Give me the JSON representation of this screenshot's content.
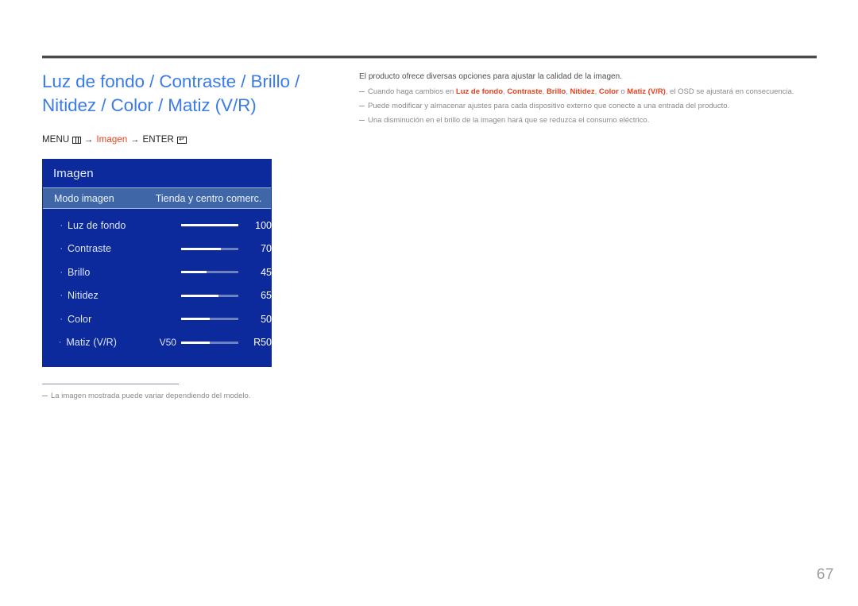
{
  "page": {
    "number": "67",
    "title": "Luz de fondo / Contraste / Brillo /\nNitidez / Color / Matiz (V/R)"
  },
  "breadcrumb": {
    "menu_label": "MENU",
    "menu_icon": "menu-grid-icon",
    "arrow1": "→",
    "target": "Imagen",
    "arrow2": "→",
    "enter_label": "ENTER",
    "enter_icon": "enter-key-icon"
  },
  "osd": {
    "header_title": "Imagen",
    "selected_row": {
      "label": "Modo imagen",
      "value": "Tienda y centro comerc."
    },
    "rows": [
      {
        "bullet": "·",
        "label": "Luz de fondo",
        "left_label": "",
        "value": "100",
        "fill_percent": 100
      },
      {
        "bullet": "·",
        "label": "Contraste",
        "left_label": "",
        "value": "70",
        "fill_percent": 70
      },
      {
        "bullet": "·",
        "label": "Brillo",
        "left_label": "",
        "value": "45",
        "fill_percent": 45
      },
      {
        "bullet": "·",
        "label": "Nitidez",
        "left_label": "",
        "value": "65",
        "fill_percent": 65
      },
      {
        "bullet": "·",
        "label": "Color",
        "left_label": "",
        "value": "50",
        "fill_percent": 50
      },
      {
        "bullet": "·",
        "label": "Matiz (V/R)",
        "left_label": "V50",
        "value": "R50",
        "fill_percent": 50
      }
    ],
    "colors": {
      "panel_bg": "#0c2a9c",
      "selected_bg": "#3f67a8",
      "track_bg": "#6f82c0",
      "fill": "#ffffff"
    }
  },
  "panel_footnote": {
    "dash": "—",
    "text": "La imagen mostrada puede variar dependiendo del modelo."
  },
  "right": {
    "intro": "El producto ofrece diversas opciones para ajustar la calidad de la imagen.",
    "notes": [
      {
        "dash": "—",
        "parts": [
          {
            "text": "Cuando haga cambios en ",
            "accent": false
          },
          {
            "text": "Luz de fondo",
            "accent": true
          },
          {
            "text": ", ",
            "accent": false
          },
          {
            "text": "Contraste",
            "accent": true
          },
          {
            "text": ", ",
            "accent": false
          },
          {
            "text": "Brillo",
            "accent": true
          },
          {
            "text": ", ",
            "accent": false
          },
          {
            "text": "Nitidez",
            "accent": true
          },
          {
            "text": ", ",
            "accent": false
          },
          {
            "text": "Color",
            "accent": true
          },
          {
            "text": " o ",
            "accent": false
          },
          {
            "text": "Matiz (V/R)",
            "accent": true
          },
          {
            "text": ", el OSD se ajustará en consecuencia.",
            "accent": false
          }
        ]
      },
      {
        "dash": "—",
        "parts": [
          {
            "text": "Puede modificar y almacenar ajustes para cada dispositivo externo que conecte a una entrada del producto.",
            "accent": false
          }
        ]
      },
      {
        "dash": "—",
        "parts": [
          {
            "text": "Una disminución en el brillo de la imagen hará que se reduzca el consumo eléctrico.",
            "accent": false
          }
        ]
      }
    ]
  },
  "theme": {
    "title_blue": "#3b7ce6",
    "accent_red": "#e8411f",
    "rule_dark": "#4a4a4a",
    "note_gray": "#8a8a8a"
  }
}
